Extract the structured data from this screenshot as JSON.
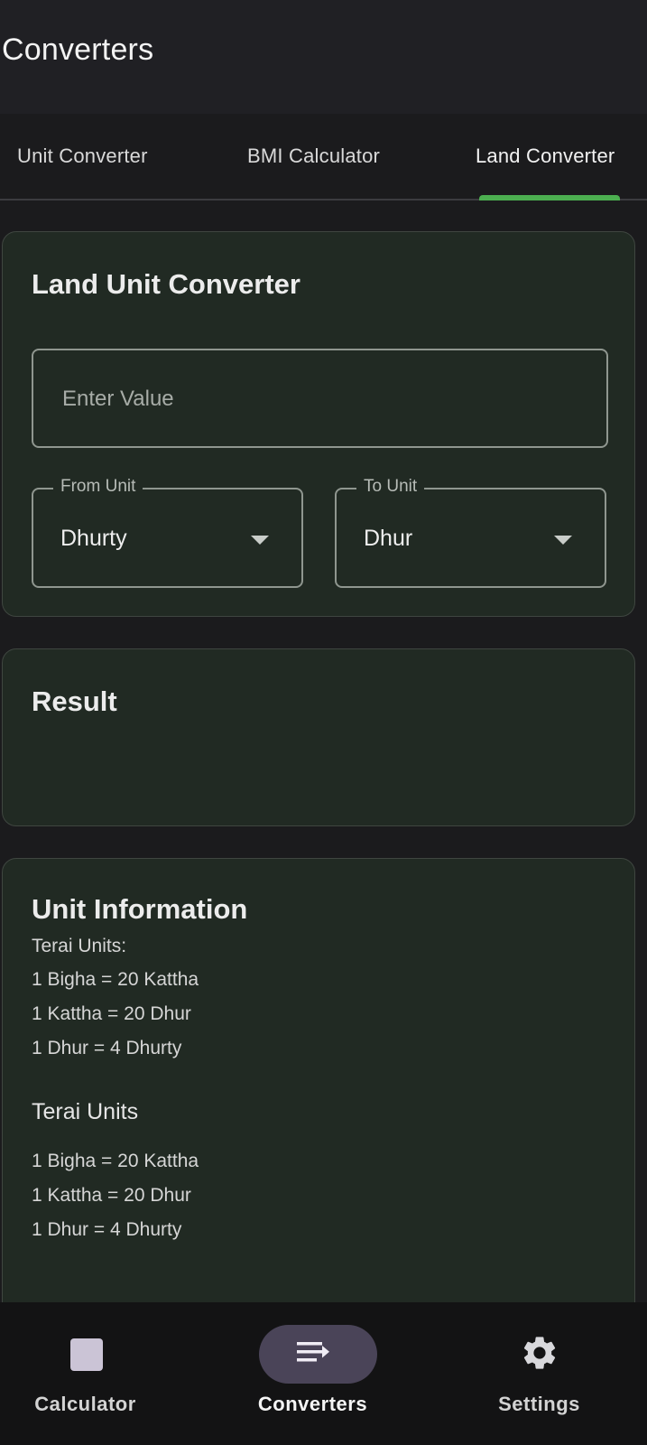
{
  "appbar": {
    "title": "Converters"
  },
  "tabs": [
    {
      "label": "Unit Converter",
      "selected": false
    },
    {
      "label": "BMI Calculator",
      "selected": false
    },
    {
      "label": "Land Converter",
      "selected": true
    }
  ],
  "accent_color": "#4caf50",
  "converter": {
    "title": "Land Unit Converter",
    "value_placeholder": "Enter Value",
    "value": "",
    "from_label": "From Unit",
    "from_value": "Dhurty",
    "to_label": "To Unit",
    "to_value": "Dhur"
  },
  "result": {
    "title": "Result",
    "value": ""
  },
  "info": {
    "title": "Unit Information",
    "lines1": [
      "Terai Units:",
      "1 Bigha = 20 Kattha",
      "1 Kattha = 20 Dhur",
      "1 Dhur = 4 Dhurty"
    ],
    "subtitle": "Terai Units",
    "lines2": [
      "1 Bigha = 20 Kattha",
      "1 Kattha = 20 Dhur",
      "1 Dhur = 4 Dhurty"
    ]
  },
  "bottom_nav": [
    {
      "label": "Calculator",
      "icon": "calculator-square-icon",
      "selected": false
    },
    {
      "label": "Converters",
      "icon": "converter-lines-icon",
      "selected": true
    },
    {
      "label": "Settings",
      "icon": "gear-icon",
      "selected": false
    }
  ]
}
